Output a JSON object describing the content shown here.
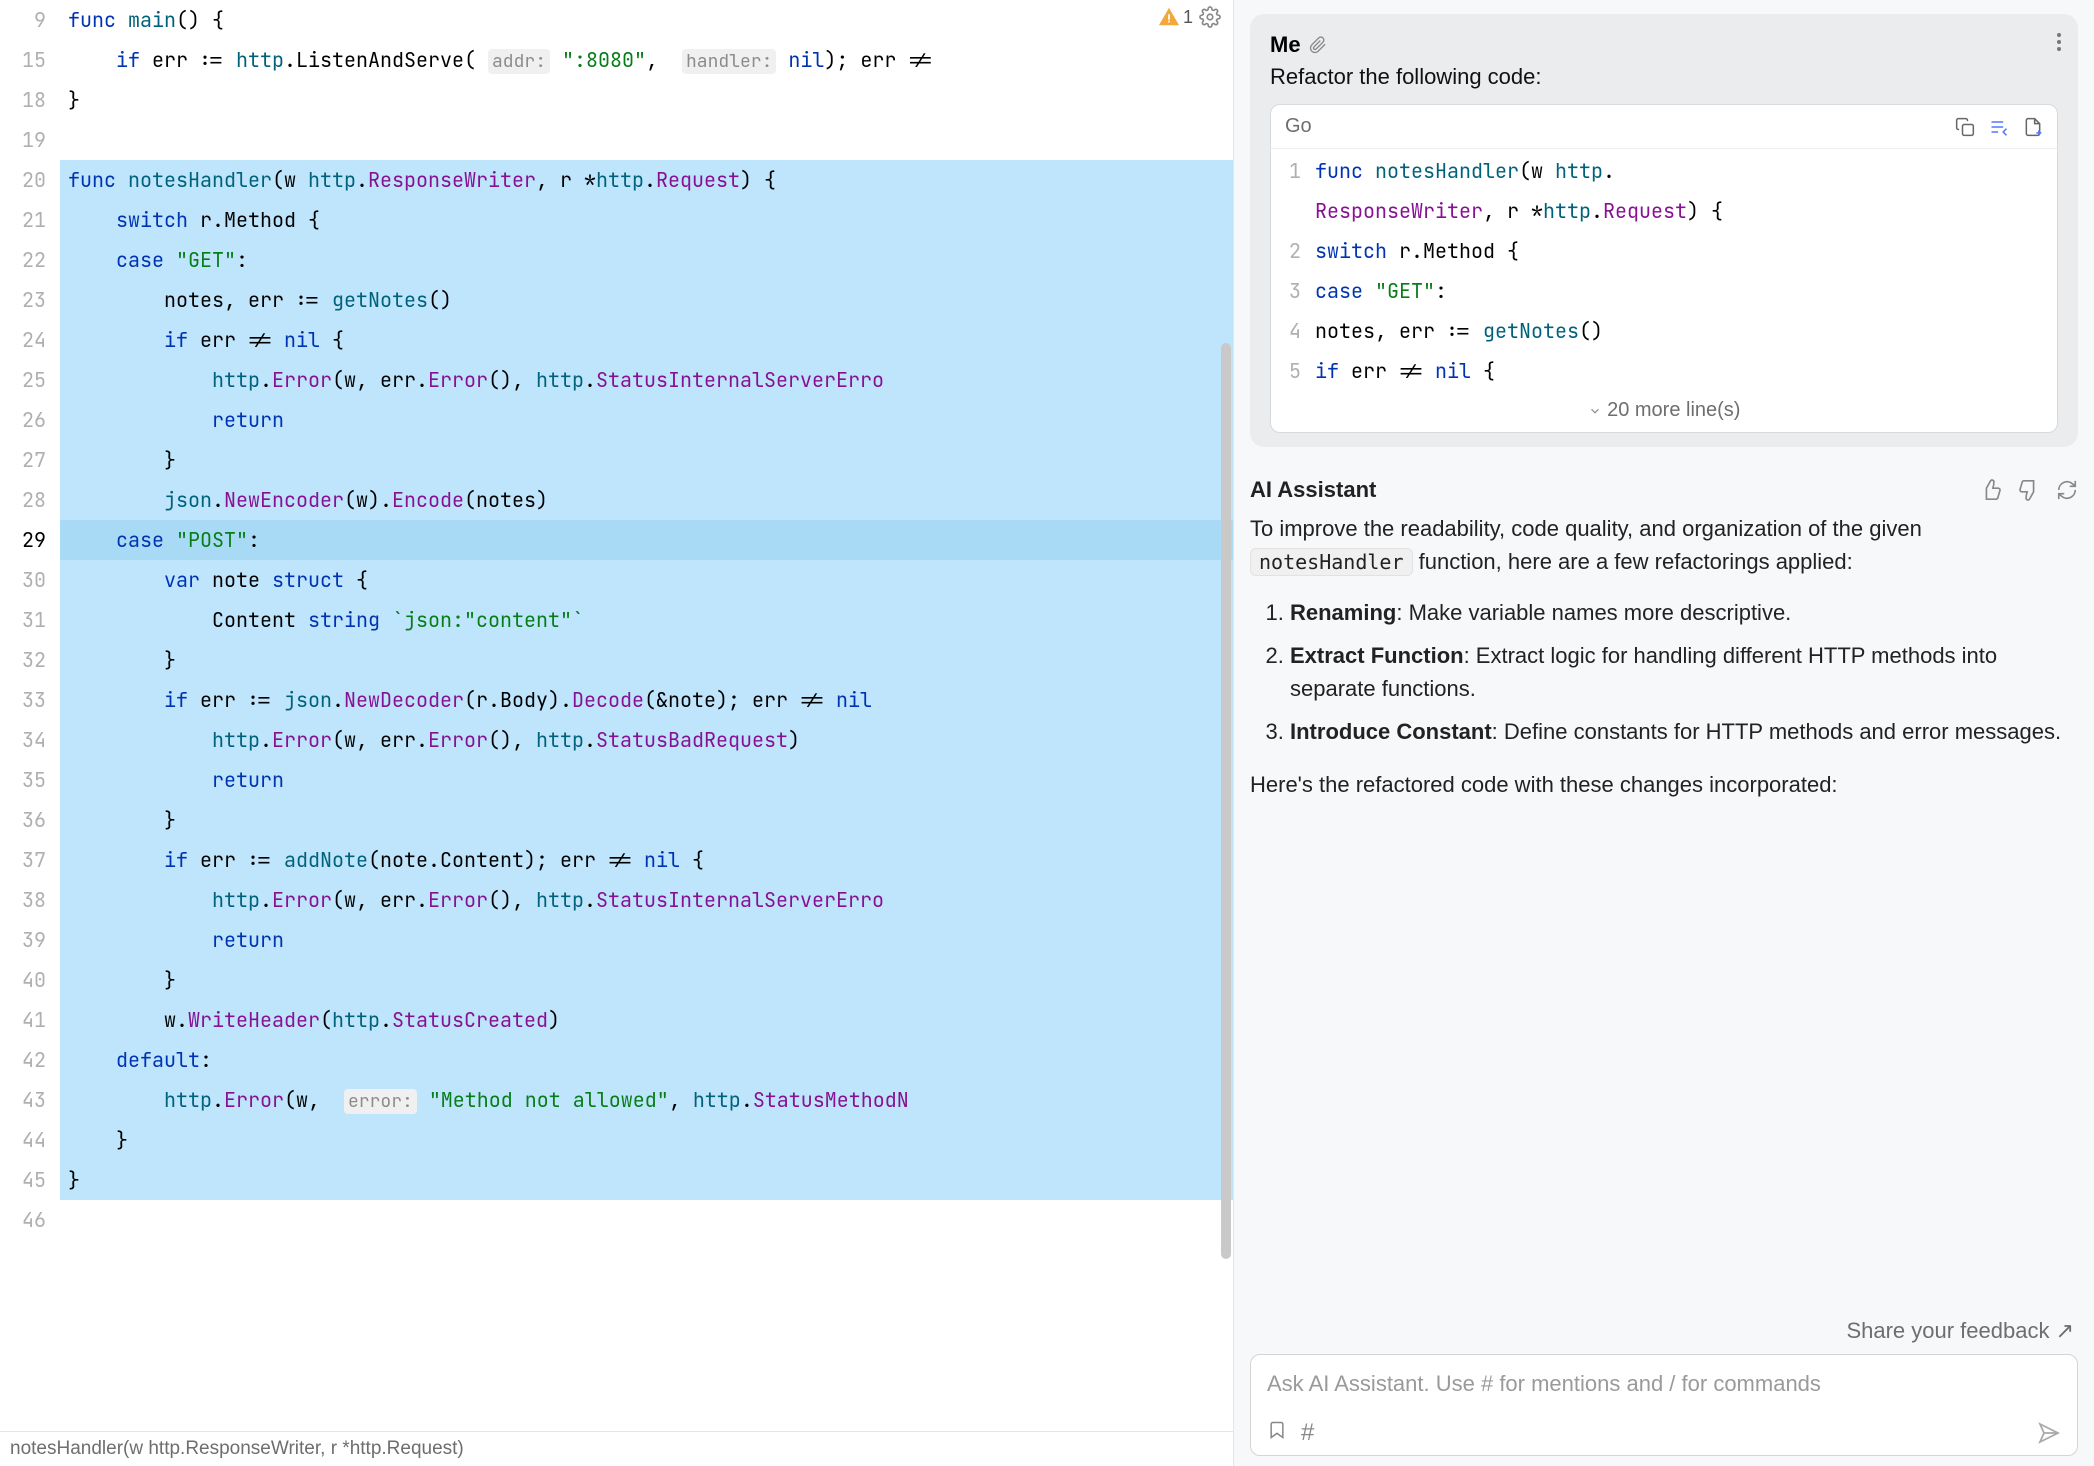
{
  "editor": {
    "warning_count": "1",
    "lines": [
      {
        "n": "9",
        "sel": false,
        "html": "<span class='kw'>func</span> <span class='fn'>main</span>() {"
      },
      {
        "n": "15",
        "sel": false,
        "html": "    <span class='kw'>if</span> err := <span class='pkg'>http</span>.ListenAndServe( <span class='hint'>addr:</span> <span class='str'>\":8080\"</span>,  <span class='hint'>handler:</span> <span class='kw'>nil</span>); err !="
      },
      {
        "n": "18",
        "sel": false,
        "html": "}"
      },
      {
        "n": "19",
        "sel": false,
        "html": ""
      },
      {
        "n": "20",
        "sel": true,
        "html": "<span class='kw'>func</span> <span class='fn'>notesHandler</span>(w <span class='pkg'>http</span>.<span class='type2'>ResponseWriter</span>, r *<span class='pkg'>http</span>.<span class='type2'>Request</span>) {"
      },
      {
        "n": "21",
        "sel": true,
        "html": "    <span class='kw'>switch</span> r.Method {"
      },
      {
        "n": "22",
        "sel": true,
        "html": "    <span class='kw'>case</span> <span class='str'>\"GET\"</span>:"
      },
      {
        "n": "23",
        "sel": true,
        "html": "        notes, err := <span class='fn'>getNotes</span>()"
      },
      {
        "n": "24",
        "sel": true,
        "html": "        <span class='kw'>if</span> err != <span class='kw'>nil</span> {"
      },
      {
        "n": "25",
        "sel": true,
        "html": "            <span class='pkg'>http</span>.<span class='type2'>Error</span>(w, err.<span class='type2'>Error</span>(), <span class='pkg'>http</span>.<span class='type2'>StatusInternalServerErro</span>"
      },
      {
        "n": "26",
        "sel": true,
        "html": "            <span class='kw'>return</span>"
      },
      {
        "n": "27",
        "sel": true,
        "html": "        }"
      },
      {
        "n": "28",
        "sel": true,
        "html": "        <span class='pkg'>json</span>.<span class='type2'>NewEncoder</span>(w).<span class='type2'>Encode</span>(notes)"
      },
      {
        "n": "29",
        "sel": true,
        "cur": true,
        "html": "    <span class='kw'>case</span> <span class='str'>\"POST\"</span>:"
      },
      {
        "n": "30",
        "sel": true,
        "html": "        <span class='kw'>var</span> note <span class='kw'>struct</span> {"
      },
      {
        "n": "31",
        "sel": true,
        "html": "            Content <span class='kw'>string</span> <span class='str'>`json:\"content\"`</span>"
      },
      {
        "n": "32",
        "sel": true,
        "html": "        }"
      },
      {
        "n": "33",
        "sel": true,
        "html": "        <span class='kw'>if</span> err := <span class='pkg'>json</span>.<span class='type2'>NewDecoder</span>(r.Body).<span class='type2'>Decode</span>(&amp;note); err != <span class='kw'>nil</span>"
      },
      {
        "n": "34",
        "sel": true,
        "html": "            <span class='pkg'>http</span>.<span class='type2'>Error</span>(w, err.<span class='type2'>Error</span>(), <span class='pkg'>http</span>.<span class='type2'>StatusBadRequest</span>)"
      },
      {
        "n": "35",
        "sel": true,
        "html": "            <span class='kw'>return</span>"
      },
      {
        "n": "36",
        "sel": true,
        "html": "        }"
      },
      {
        "n": "37",
        "sel": true,
        "html": "        <span class='kw'>if</span> err := <span class='fn'>addNote</span>(note.Content); err != <span class='kw'>nil</span> {"
      },
      {
        "n": "38",
        "sel": true,
        "html": "            <span class='pkg'>http</span>.<span class='type2'>Error</span>(w, err.<span class='type2'>Error</span>(), <span class='pkg'>http</span>.<span class='type2'>StatusInternalServerErro</span>"
      },
      {
        "n": "39",
        "sel": true,
        "html": "            <span class='kw'>return</span>"
      },
      {
        "n": "40",
        "sel": true,
        "html": "        }"
      },
      {
        "n": "41",
        "sel": true,
        "html": "        w.<span class='type2'>WriteHeader</span>(<span class='pkg'>http</span>.<span class='type2'>StatusCreated</span>)"
      },
      {
        "n": "42",
        "sel": true,
        "html": "    <span class='kw'>default</span>:"
      },
      {
        "n": "43",
        "sel": true,
        "html": "        <span class='pkg'>http</span>.<span class='type2'>Error</span>(w,  <span class='hint'>error:</span> <span class='str'>\"Method not allowed\"</span>, <span class='pkg'>http</span>.<span class='type2'>StatusMethodN</span>"
      },
      {
        "n": "44",
        "sel": true,
        "html": "    }"
      },
      {
        "n": "45",
        "sel": true,
        "html": "}"
      },
      {
        "n": "46",
        "sel": false,
        "html": ""
      }
    ],
    "status_text": "notesHandler(w http.ResponseWriter, r *http.Request)"
  },
  "chat": {
    "me_label": "Me",
    "me_prompt": "Refactor the following code:",
    "me_code_lang": "Go",
    "me_code_lines": [
      {
        "n": "1",
        "html": "<span class='kw'>func</span> <span class='fn'>notesHandler</span>(w <span class='pkg'>http</span>."
      },
      {
        "n": "",
        "html": "<span class='type2'>ResponseWriter</span>, r *<span class='pkg'>http</span>.<span class='type2'>Request</span>) {"
      },
      {
        "n": "2",
        "html": "    <span class='kw'>switch</span> r.Method {"
      },
      {
        "n": "3",
        "html": "    <span class='kw'>case</span> <span class='str'>\"GET\"</span>:"
      },
      {
        "n": "4",
        "html": "        notes, err := <span class='fn'>getNotes</span>()"
      },
      {
        "n": "5",
        "html": "        <span class='kw'>if</span> err != <span class='kw'>nil</span> {"
      }
    ],
    "more_lines_text": "20 more line(s)",
    "assistant_title": "AI Assistant",
    "assistant_intro_1": "To improve the readability, code quality, and organization of the given ",
    "assistant_inline_code": "notesHandler",
    "assistant_intro_2": " function, here are a few refactorings applied:",
    "ref_items": [
      {
        "b": "Renaming",
        "t": ": Make variable names more descriptive."
      },
      {
        "b": "Extract Function",
        "t": ": Extract logic for handling different HTTP methods into separate functions."
      },
      {
        "b": "Introduce Constant",
        "t": ": Define constants for HTTP methods and error messages."
      }
    ],
    "assistant_outro": "Here's the refactored code with these changes incorporated:",
    "feedback_text": "Share your feedback ↗",
    "input_placeholder": "Ask AI Assistant. Use # for mentions and / for commands"
  }
}
